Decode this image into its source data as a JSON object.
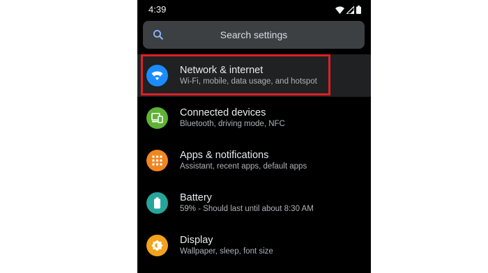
{
  "status_bar": {
    "time": "4:39",
    "icons": [
      "wifi-icon",
      "signal-icon",
      "battery-icon"
    ]
  },
  "search": {
    "placeholder": "Search settings",
    "icon": "search-icon"
  },
  "settings_items": [
    {
      "title": "Network & internet",
      "subtitle": "Wi-Fi, mobile, data usage, and hotspot",
      "icon": "wifi-icon",
      "color": "#1a8cff",
      "selected": true
    },
    {
      "title": "Connected devices",
      "subtitle": "Bluetooth, driving mode, NFC",
      "icon": "devices-icon",
      "color": "#5fb236"
    },
    {
      "title": "Apps & notifications",
      "subtitle": "Assistant, recent apps, default apps",
      "icon": "apps-grid-icon",
      "color": "#f18621"
    },
    {
      "title": "Battery",
      "subtitle": "59% - Should last until about 8:30 AM",
      "icon": "battery-icon",
      "color": "#26a69a"
    },
    {
      "title": "Display",
      "subtitle": "Wallpaper, sleep, font size",
      "icon": "brightness-icon",
      "color": "#f2a31c"
    }
  ],
  "colors": {
    "background": "#000000",
    "search_bar": "#3c4043",
    "highlight": "#e01e25",
    "selected_row": "#1f2123"
  }
}
